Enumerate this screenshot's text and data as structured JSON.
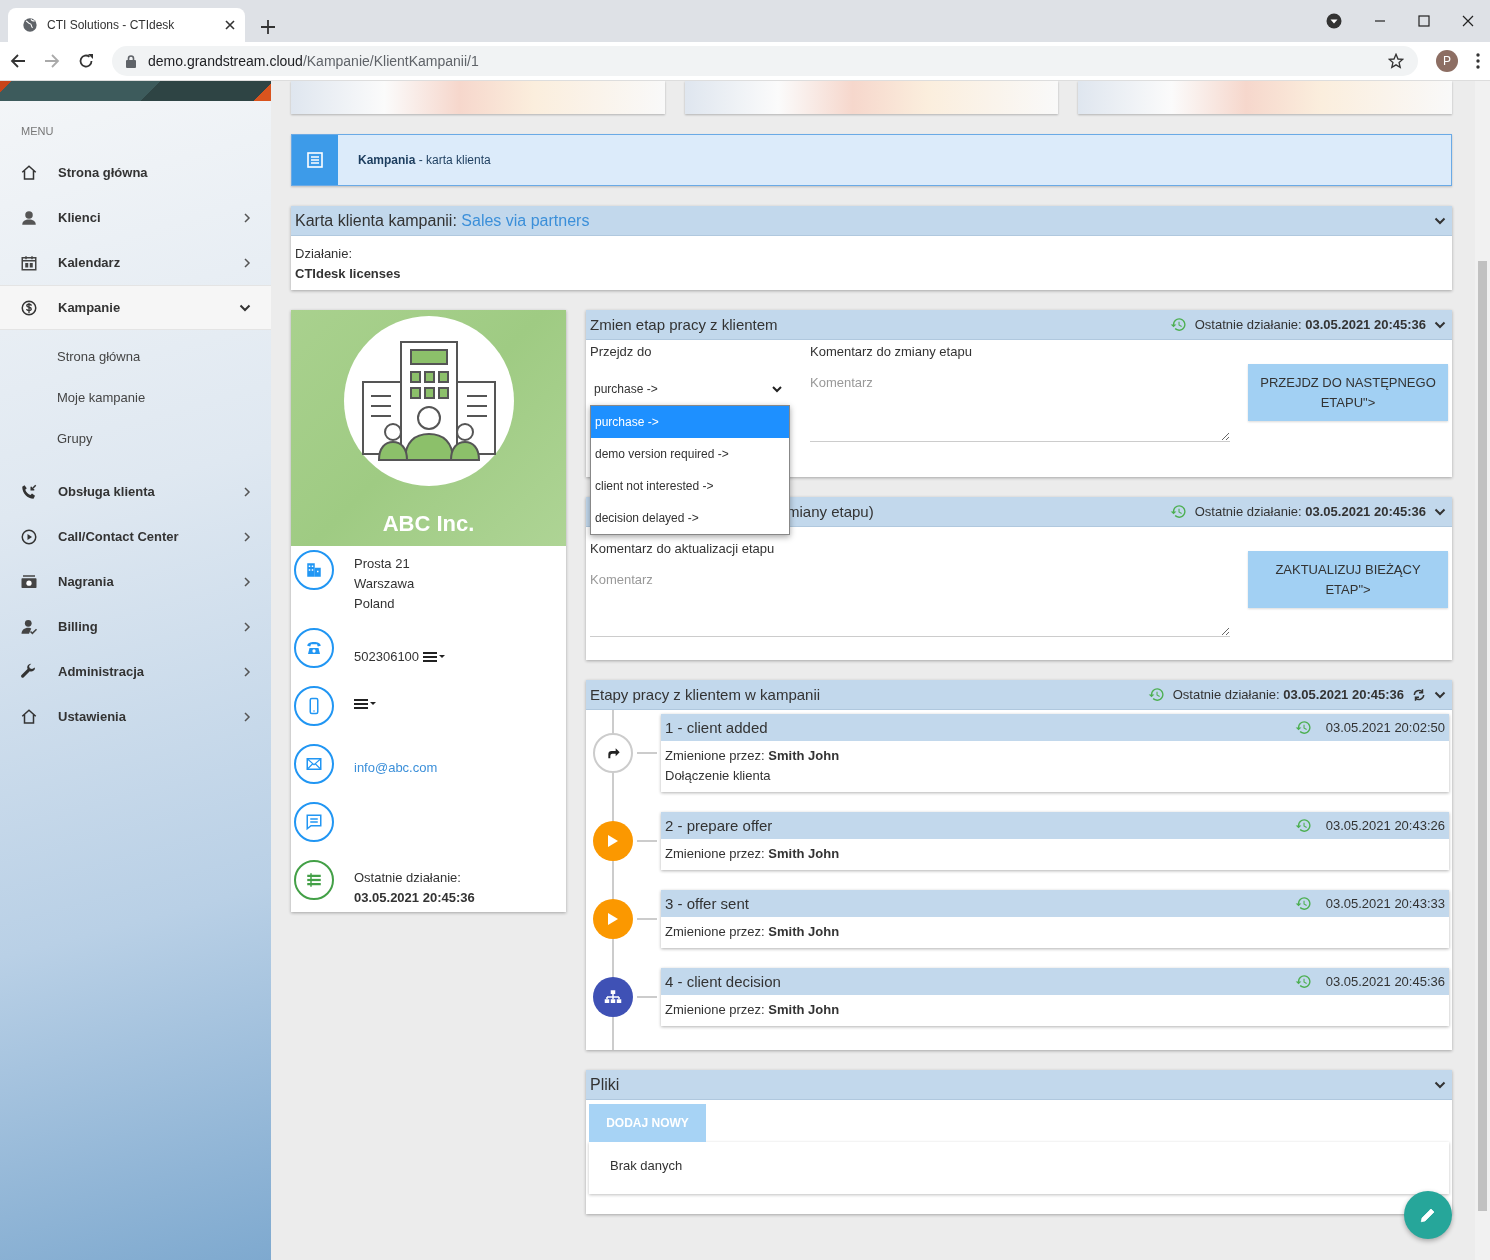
{
  "browser": {
    "tab_title": "CTI Solutions - CTIdesk",
    "url_host": "demo.grandstream.cloud",
    "url_path": "/Kampanie/KlientKampanii/1",
    "profile_initial": "P"
  },
  "sidebar": {
    "menu_label": "MENU",
    "items": [
      {
        "label": "Strona główna",
        "selected": false
      },
      {
        "label": "Klienci",
        "expanded": false,
        "selected": false
      },
      {
        "label": "Kalendarz",
        "expanded": false,
        "selected": false
      },
      {
        "label": "Kampanie",
        "expanded": true,
        "selected": true,
        "children": [
          {
            "label": "Strona główna"
          },
          {
            "label": "Moje kampanie"
          },
          {
            "label": "Grupy"
          }
        ]
      },
      {
        "label": "Obsługa klienta",
        "expanded": false,
        "selected": false
      },
      {
        "label": "Call/Contact Center",
        "expanded": false,
        "selected": false
      },
      {
        "label": "Nagrania",
        "expanded": false,
        "selected": false
      },
      {
        "label": "Billing",
        "expanded": false,
        "selected": false
      },
      {
        "label": "Administracja",
        "expanded": false,
        "selected": false
      },
      {
        "label": "Ustawienia",
        "expanded": false,
        "selected": false
      }
    ]
  },
  "page_header": {
    "title": "**Kampania** - karta klienta"
  },
  "campaign": {
    "label": "Karta klienta kampanii:",
    "name": "Sales via partners",
    "action_label": "Działanie:",
    "action_value": "CTIdesk licenses"
  },
  "client": {
    "name": "ABC Inc.",
    "rows": [
      {
        "kind": "address",
        "lines": [
          "Prosta 21",
          "Warszawa",
          "Poland"
        ]
      },
      {
        "kind": "phone",
        "value": "502306100",
        "menu": true
      },
      {
        "kind": "mobile",
        "menu": true
      },
      {
        "kind": "email",
        "value": "info@abc.com"
      },
      {
        "kind": "message"
      },
      {
        "kind": "activity",
        "label": "Ostatnie działanie:",
        "value": "03.05.2021 20:45:36"
      }
    ]
  },
  "change_stage": {
    "title": "Zmien etap pracy z klientem",
    "last_label": "Ostatnie działanie:",
    "last_value": "03.05.2021 20:45:36",
    "select_label": "Przejdz do",
    "select_value": "purchase ->",
    "options": [
      {
        "label": "purchase ->",
        "selected": true
      },
      {
        "label": "demo version required ->",
        "selected": false
      },
      {
        "label": "client not interested ->",
        "selected": false
      },
      {
        "label": "decision delayed ->",
        "selected": false
      }
    ],
    "comment_label": "Komentarz do zmiany etapu",
    "comment_placeholder": "Komentarz",
    "button": "PRZEJDZ DO NASTĘPNEGO ETAPU\">"
  },
  "update_stage": {
    "title": "miany etapu)",
    "last_label": "Ostatnie działanie:",
    "last_value": "03.05.2021 20:45:36",
    "comment_label": "Komentarz do aktualizacji etapu",
    "comment_placeholder": "Komentarz",
    "button": "ZAKTUALIZUJ BIEŻĄCY ETAP\">"
  },
  "stages": {
    "title": "Etapy pracy z klientem w kampanii",
    "last_label": "Ostatnie działanie:",
    "last_value": "03.05.2021 20:45:36",
    "items": [
      {
        "kind": "start",
        "title": "1 - client added",
        "time": "03.05.2021 20:02:50",
        "changed_by_label": "Zmienione przez:",
        "changed_by": "Smith John",
        "note": "Dołączenie klienta"
      },
      {
        "kind": "play",
        "title": "2 - prepare offer",
        "time": "03.05.2021 20:43:26",
        "changed_by_label": "Zmienione przez:",
        "changed_by": "Smith John"
      },
      {
        "kind": "play",
        "title": "3 - offer sent",
        "time": "03.05.2021 20:43:33",
        "changed_by_label": "Zmienione przez:",
        "changed_by": "Smith John"
      },
      {
        "kind": "decision",
        "title": "4 - client decision",
        "time": "03.05.2021 20:45:36",
        "changed_by_label": "Zmienione przez:",
        "changed_by": "Smith John"
      }
    ]
  },
  "files": {
    "title": "Pliki",
    "add_button": "DODAJ NOWY",
    "empty": "Brak danych"
  }
}
